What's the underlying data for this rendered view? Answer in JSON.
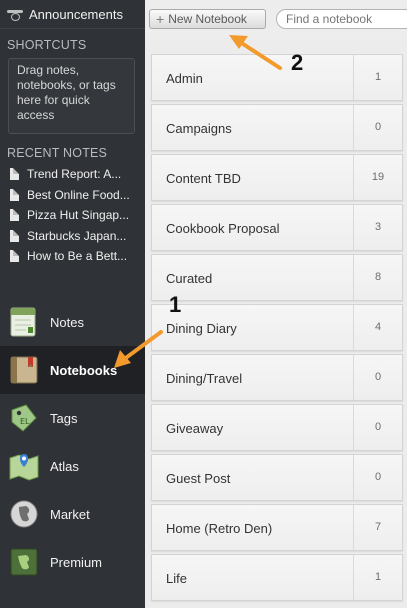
{
  "sidebar": {
    "announcements": "Announcements",
    "shortcuts_title": "SHORTCUTS",
    "shortcuts_hint": "Drag notes, notebooks, or tags here for quick access",
    "recent_title": "RECENT NOTES",
    "recent": [
      "Trend Report: A...",
      "Best Online Food...",
      "Pizza Hut Singap...",
      "Starbucks Japan...",
      "How to Be a Bett..."
    ],
    "nav": [
      {
        "label": "Notes",
        "icon": "notes-icon"
      },
      {
        "label": "Notebooks",
        "icon": "notebooks-icon",
        "active": true
      },
      {
        "label": "Tags",
        "icon": "tags-icon"
      },
      {
        "label": "Atlas",
        "icon": "atlas-icon"
      },
      {
        "label": "Market",
        "icon": "market-icon"
      },
      {
        "label": "Premium",
        "icon": "premium-icon"
      }
    ]
  },
  "toolbar": {
    "new_notebook_label": "New Notebook",
    "search_placeholder": "Find a notebook"
  },
  "notebooks": [
    {
      "name": "Admin",
      "count": "1"
    },
    {
      "name": "Campaigns",
      "count": "0"
    },
    {
      "name": "Content TBD",
      "count": "19"
    },
    {
      "name": "Cookbook Proposal",
      "count": "3"
    },
    {
      "name": "Curated",
      "count": "8"
    },
    {
      "name": "Dining Diary",
      "count": "4"
    },
    {
      "name": "Dining/Travel",
      "count": "0"
    },
    {
      "name": "Giveaway",
      "count": "0"
    },
    {
      "name": "Guest Post",
      "count": "0"
    },
    {
      "name": "Home (Retro Den)",
      "count": "7"
    },
    {
      "name": "Life",
      "count": "1"
    }
  ],
  "annotations": {
    "label_1": "1",
    "label_2": "2",
    "arrow_color": "#f39a2c"
  },
  "colors": {
    "sidebar_bg": "#2f3236",
    "active_nav_bg": "#1f2124",
    "list_bg": "#ececec"
  }
}
